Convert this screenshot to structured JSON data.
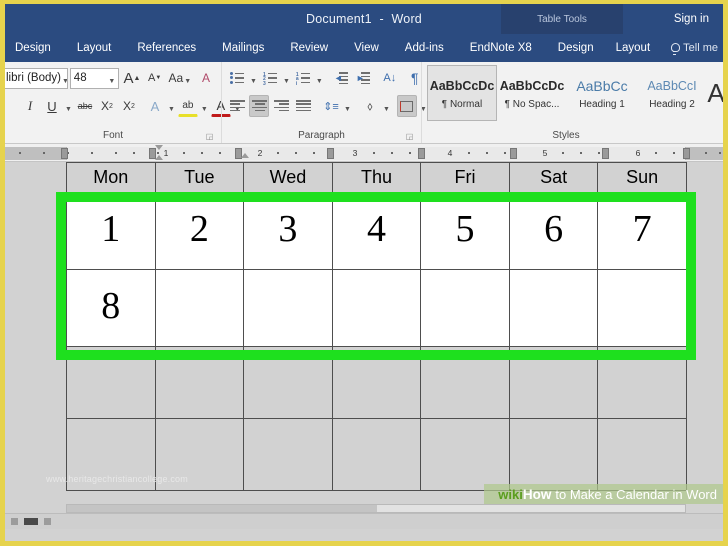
{
  "window": {
    "title_document": "Document1",
    "title_sep": "-",
    "title_app": "Word",
    "contextual_group": "Table Tools",
    "sign_in": "Sign in"
  },
  "ribbon": {
    "tabs": [
      "Design",
      "Layout",
      "References",
      "Mailings",
      "Review",
      "View",
      "Add-ins",
      "EndNote X8"
    ],
    "contextual_tabs": [
      "Design",
      "Layout"
    ],
    "tell_me": "Tell me",
    "groups": {
      "font": {
        "label": "Font",
        "font_name": "libri (Body)",
        "font_size": "48",
        "dialog_launcher": "◲",
        "buttons_row1": [
          "grow-font",
          "shrink-font",
          "change-case",
          "clear-formatting"
        ],
        "buttons_row2": [
          "italic",
          "underline",
          "strikethrough",
          "subscript",
          "superscript",
          "text-effects",
          "text-highlight",
          "font-color"
        ],
        "glyph_grow": "A",
        "glyph_shrink": "A",
        "glyph_case": "Aa",
        "glyph_clear": "A",
        "glyph_italic": "I",
        "glyph_underline": "U",
        "glyph_strike": "abc",
        "glyph_subscript": "X",
        "glyph_superscript": "X",
        "glyph_effects": "A",
        "glyph_highlight": "ab",
        "glyph_fontcolor": "A"
      },
      "paragraph": {
        "label": "Paragraph",
        "dialog_launcher": "◲",
        "buttons_row1": [
          "bullets",
          "numbering",
          "multilevel-list",
          "decrease-indent",
          "increase-indent",
          "sort",
          "show-formatting-marks"
        ],
        "buttons_row2": [
          "align-left",
          "align-center",
          "align-right",
          "justify",
          "line-spacing",
          "shading",
          "borders"
        ],
        "glyph_sort": "A↓",
        "glyph_pilcrow": "¶"
      },
      "styles": {
        "label": "Styles",
        "items": [
          {
            "preview": "AaBbCcDc",
            "name": "¶ Normal",
            "selected": true,
            "kind": "normal"
          },
          {
            "preview": "AaBbCcDc",
            "name": "¶ No Spac...",
            "selected": false,
            "kind": "normal"
          },
          {
            "preview": "AaBbCс",
            "name": "Heading 1",
            "selected": false,
            "kind": "h1"
          },
          {
            "preview": "AaBbCcІ",
            "name": "Heading 2",
            "selected": false,
            "kind": "h2"
          }
        ],
        "more_glyph": "A"
      }
    }
  },
  "ruler": {
    "numbers": [
      "1",
      "2",
      "3",
      "4",
      "5",
      "6"
    ]
  },
  "document": {
    "table": {
      "headers": [
        "Mon",
        "Tue",
        "Wed",
        "Thu",
        "Fri",
        "Sat",
        "Sun"
      ],
      "rows": [
        [
          "1",
          "2",
          "3",
          "4",
          "5",
          "6",
          "7"
        ],
        [
          "8",
          "",
          "",
          "",
          "",
          "",
          ""
        ],
        [
          "",
          "",
          "",
          "",
          "",
          "",
          ""
        ],
        [
          "",
          "",
          "",
          "",
          "",
          "",
          ""
        ]
      ]
    },
    "watermark": "www.heritagechristiancollege.com",
    "highlight_color": "#1ee01e"
  },
  "banner": {
    "wiki": "wiki",
    "how": "How",
    "rest": "to Make a Calendar in Word"
  },
  "colors": {
    "ribbon_blue": "#2b4b80",
    "contextual_blue": "#28416e",
    "border_yellow": "#e6d34d",
    "canvas_gray": "#d2d2d2",
    "highlight_green": "#1ee01e"
  }
}
